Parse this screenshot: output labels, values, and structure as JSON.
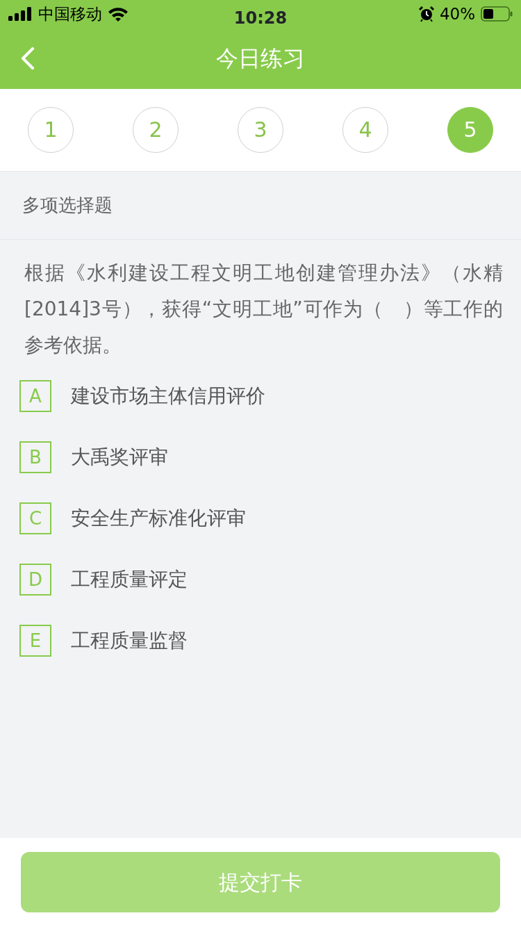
{
  "status_bar": {
    "carrier": "中国移动",
    "time": "10:28",
    "battery": "40%"
  },
  "nav_bar": {
    "title": "今日练习"
  },
  "question_tabs": [
    {
      "label": "1",
      "selected": false
    },
    {
      "label": "2",
      "selected": false
    },
    {
      "label": "3",
      "selected": false
    },
    {
      "label": "4",
      "selected": false
    },
    {
      "label": "5",
      "selected": true
    }
  ],
  "question": {
    "type": "多项选择题",
    "text": "根据《水利建设工程文明工地创建管理办法》（水精[2014]3号），获得“文明工地”可作为（　）等工作的参考依据。",
    "options": [
      {
        "letter": "A",
        "text": "建设市场主体信用评价",
        "selected": false
      },
      {
        "letter": "B",
        "text": "大禹奖评审",
        "selected": false
      },
      {
        "letter": "C",
        "text": "安全生产标准化评审",
        "selected": false
      },
      {
        "letter": "D",
        "text": "工程质量评定",
        "selected": false
      },
      {
        "letter": "E",
        "text": "工程质量监督",
        "selected": false
      }
    ]
  },
  "submit_button": {
    "label": "提交打卡",
    "disabled": true
  }
}
